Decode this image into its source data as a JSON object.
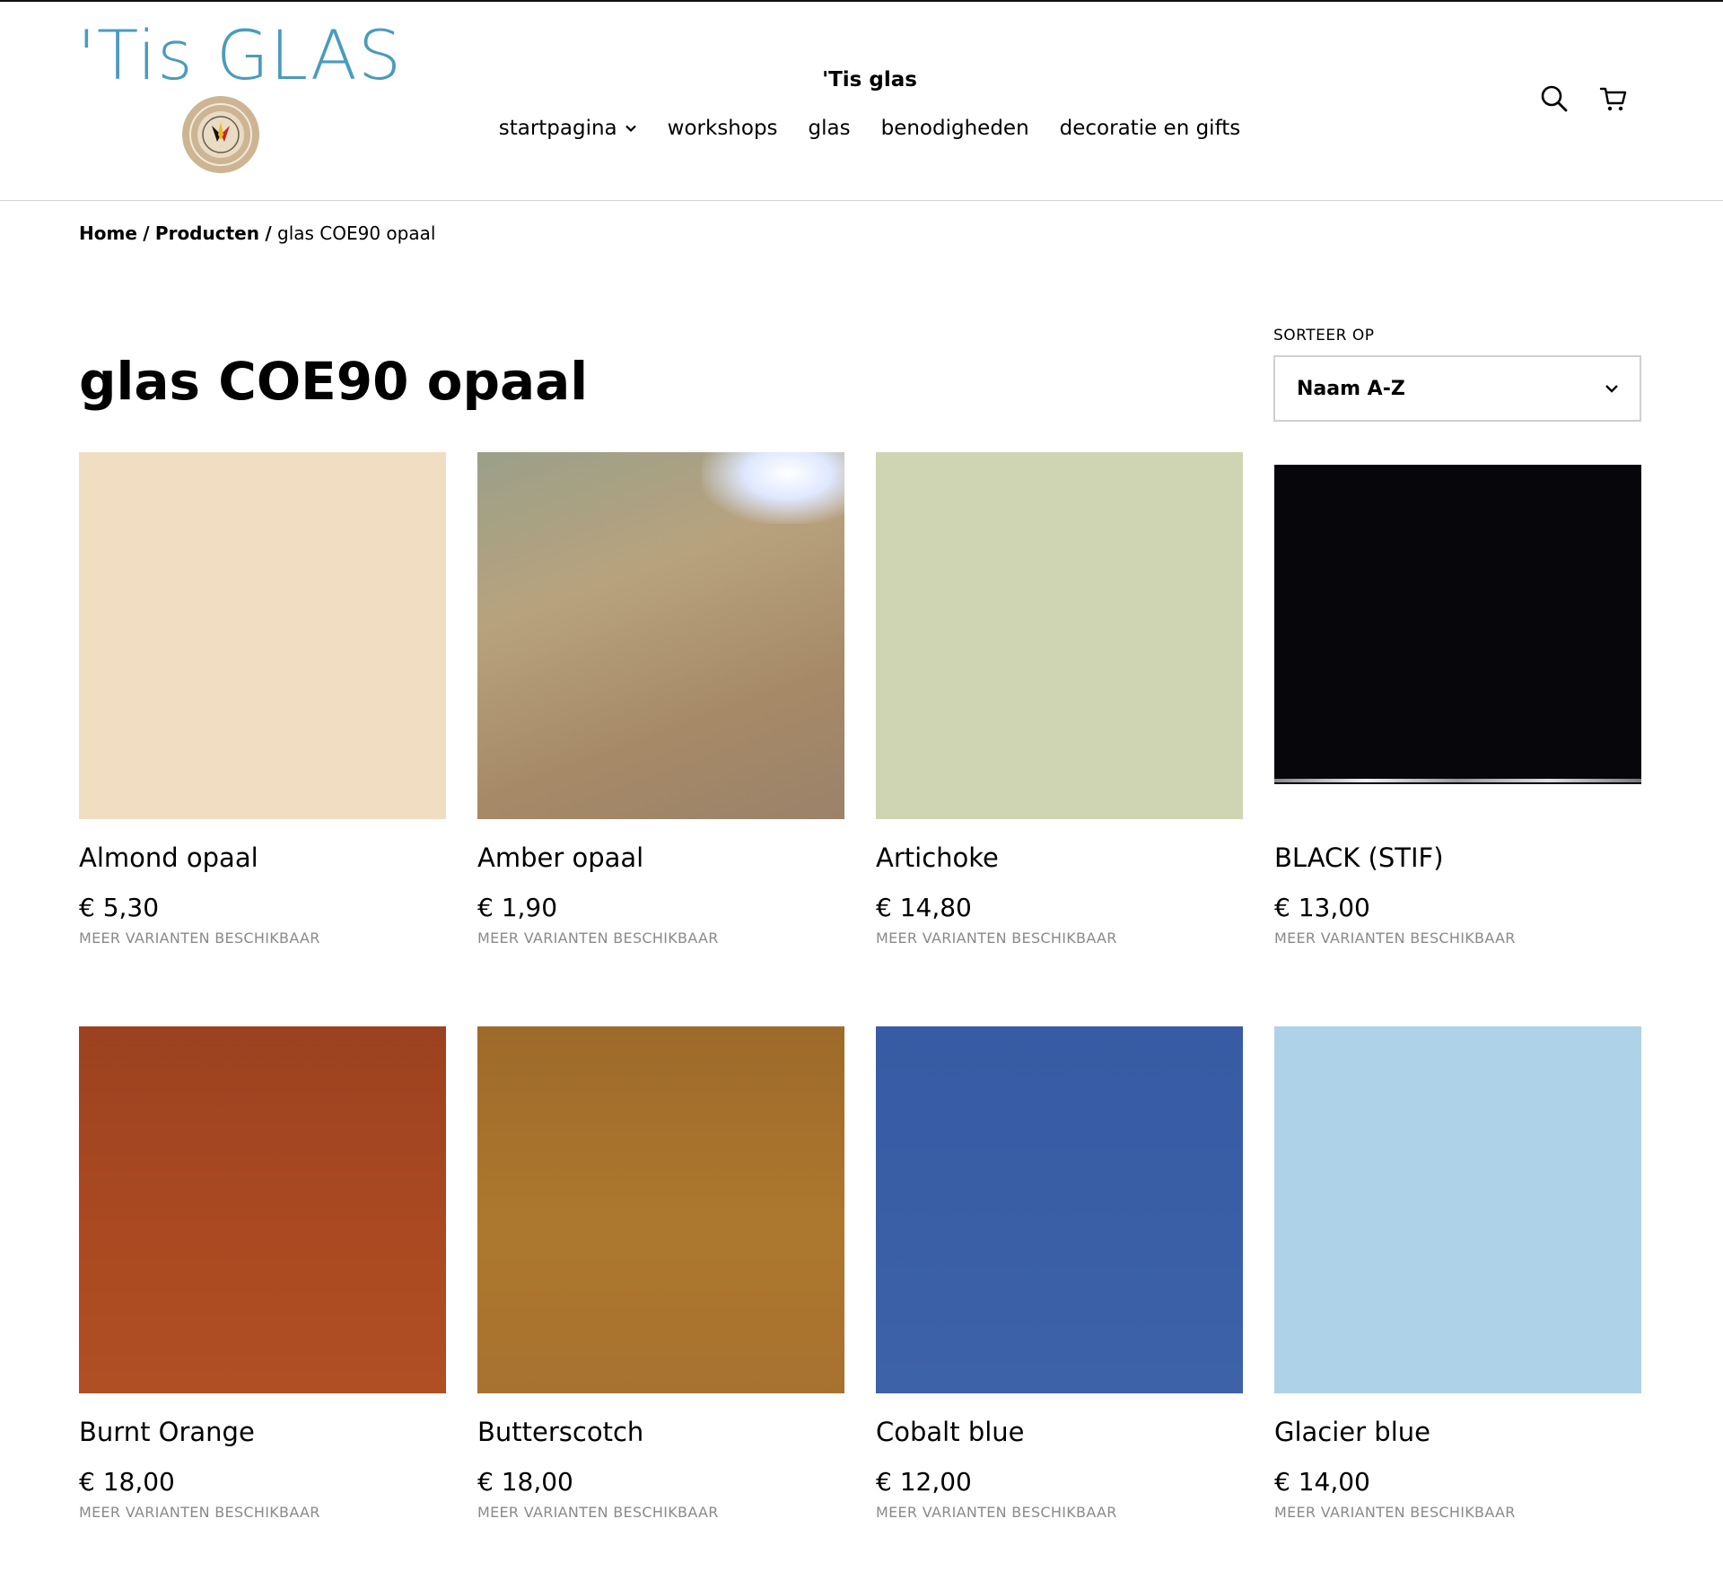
{
  "header": {
    "logo_text": "'Tis GLAS",
    "site_title": "'Tis glas",
    "nav": [
      {
        "label": "startpagina"
      },
      {
        "label": "workshops"
      },
      {
        "label": "glas"
      },
      {
        "label": "benodigheden"
      },
      {
        "label": "decoratie en gifts"
      }
    ],
    "icons": [
      "search-icon",
      "cart-icon"
    ]
  },
  "breadcrumb": {
    "home": "Home",
    "sep1": "/",
    "products": "Producten",
    "sep2": "/",
    "current": "glas COE90 opaal"
  },
  "page_title": "glas COE90 opaal",
  "sort": {
    "label": "SORTEER OP",
    "selected": "Naam A-Z"
  },
  "products": [
    {
      "name": "Almond opaal",
      "price": "€ 5,30",
      "variants": "MEER VARIANTEN BESCHIKBAAR",
      "color": "#f1ddc2"
    },
    {
      "name": "Amber opaal",
      "price": "€ 1,90",
      "variants": "MEER VARIANTEN BESCHIKBAAR",
      "color": "#a89574"
    },
    {
      "name": "Artichoke",
      "price": "€ 14,80",
      "variants": "MEER VARIANTEN BESCHIKBAAR",
      "color": "#cfd4b2"
    },
    {
      "name": "BLACK (STIF)",
      "price": "€ 13,00",
      "variants": "MEER VARIANTEN BESCHIKBAAR",
      "color": "#07060a"
    },
    {
      "name": "Burnt Orange",
      "price": "€ 18,00",
      "variants": "MEER VARIANTEN BESCHIKBAAR",
      "color": "#a84a22"
    },
    {
      "name": "Butterscotch",
      "price": "€ 18,00",
      "variants": "MEER VARIANTEN BESCHIKBAAR",
      "color": "#a9742c"
    },
    {
      "name": "Cobalt blue",
      "price": "€ 12,00",
      "variants": "MEER VARIANTEN BESCHIKBAAR",
      "color": "#3a5ea6"
    },
    {
      "name": "Glacier blue",
      "price": "€ 14,00",
      "variants": "MEER VARIANTEN BESCHIKBAAR",
      "color": "#aed2e8"
    }
  ]
}
